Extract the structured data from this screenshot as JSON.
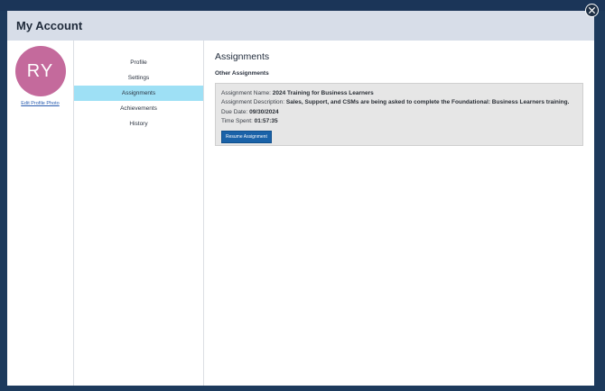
{
  "header": {
    "title": "My Account"
  },
  "avatar": {
    "initials": "RY",
    "color": "#c46a9c",
    "edit_link": "Edit Profile Photo"
  },
  "nav": {
    "items": [
      {
        "label": "Profile"
      },
      {
        "label": "Settings"
      },
      {
        "label": "Assignments",
        "active": true
      },
      {
        "label": "Achievements"
      },
      {
        "label": "History"
      }
    ]
  },
  "main": {
    "title": "Assignments",
    "subtitle": "Other Assignments",
    "assignment": {
      "name_label": "Assignment Name:",
      "name_value": "2024 Training for Business Learners",
      "desc_label": "Assignment Description:",
      "desc_value": "Sales, Support, and CSMs are being asked to complete the Foundational: Business Learners training.",
      "due_label": "Due Date:",
      "due_value": "09/30/2024",
      "time_label": "Time Spent:",
      "time_value": "01:57:35",
      "button_label": "Resume Assignment"
    }
  },
  "colors": {
    "active_nav": "#9ee0f5",
    "button": "#1a62a8",
    "header_bg": "#d7dde8"
  }
}
